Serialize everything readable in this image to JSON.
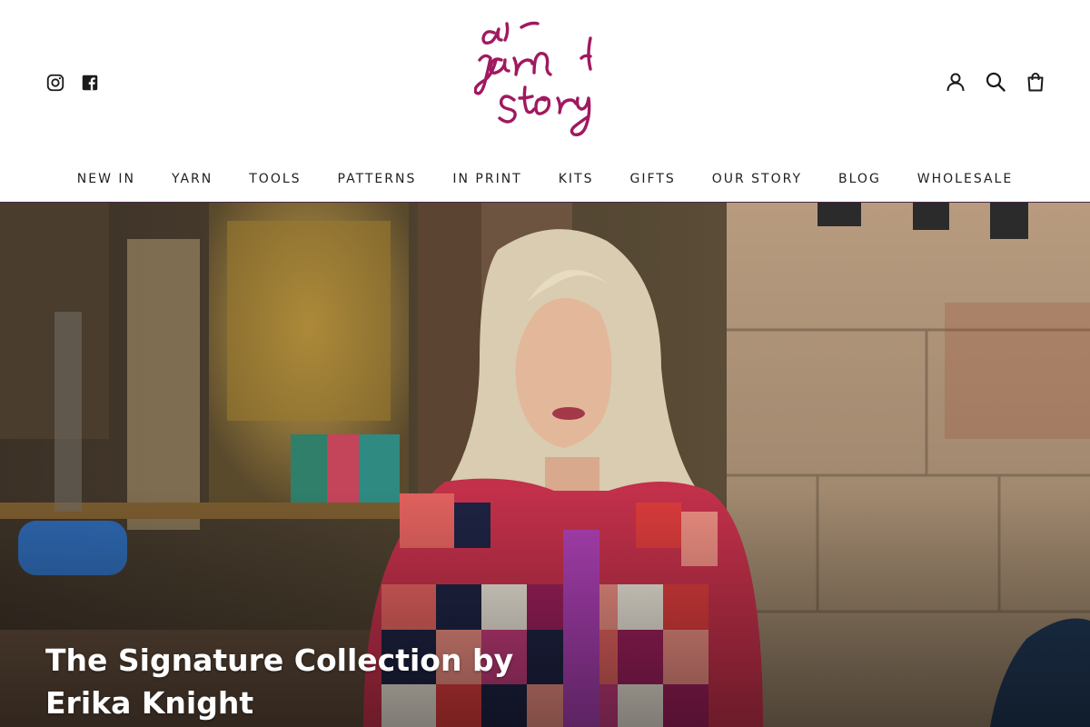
{
  "logo": {
    "text": "a yarn story",
    "color": "#a0195f"
  },
  "social": [
    {
      "name": "instagram-icon",
      "label": "Instagram"
    },
    {
      "name": "facebook-icon",
      "label": "Facebook"
    }
  ],
  "utility": [
    {
      "name": "account-icon",
      "label": "My account"
    },
    {
      "name": "search-icon",
      "label": "Search"
    },
    {
      "name": "cart-icon",
      "label": "Shopping cart"
    }
  ],
  "nav": [
    {
      "label": "NEW IN"
    },
    {
      "label": "YARN"
    },
    {
      "label": "TOOLS"
    },
    {
      "label": "PATTERNS"
    },
    {
      "label": "IN PRINT"
    },
    {
      "label": "KITS"
    },
    {
      "label": "GIFTS"
    },
    {
      "label": "OUR STORY"
    },
    {
      "label": "BLOG"
    },
    {
      "label": "WHOLESALE"
    }
  ],
  "hero": {
    "title": "The Signature Collection by Erika Knight"
  },
  "colors": {
    "header_border": "#4a2a44",
    "nav_text": "#1f1f1f",
    "hero_text": "#ffffff"
  }
}
